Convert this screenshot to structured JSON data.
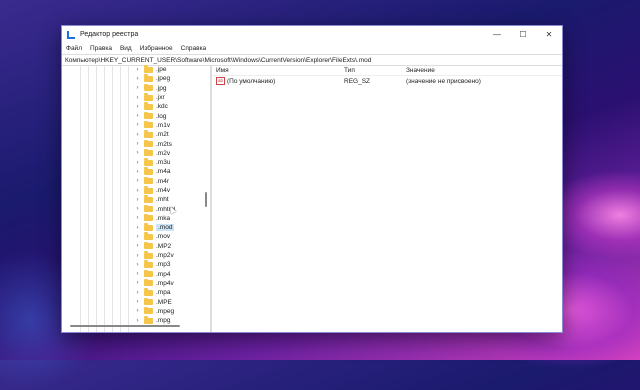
{
  "window": {
    "title": "Редактор реестра",
    "controls": {
      "minimize": "—",
      "maximize": "☐",
      "close": "✕"
    }
  },
  "menu": [
    "Файл",
    "Правка",
    "Вид",
    "Избранное",
    "Справка"
  ],
  "address": "Компьютер\\HKEY_CURRENT_USER\\Software\\Microsoft\\Windows\\CurrentVersion\\Explorer\\FileExts\\.mod",
  "tree": {
    "items": [
      ".jpe",
      ".jpeg",
      ".jpg",
      ".jxr",
      ".kdc",
      ".log",
      ".m1v",
      ".m2t",
      ".m2ts",
      ".m2v",
      ".m3u",
      ".m4a",
      ".m4r",
      ".m4v",
      ".mht",
      ".mhtml",
      ".mka",
      ".mod",
      ".mov",
      ".MP2",
      ".mp2v",
      ".mp3",
      ".mp4",
      ".mp4v",
      ".mpa",
      ".MPE",
      ".mpeg",
      ".mpg"
    ],
    "selected": ".mod"
  },
  "values": {
    "headers": {
      "name": "Имя",
      "type": "Тип",
      "data": "Значение"
    },
    "rows": [
      {
        "icon": "ab",
        "name": "(По умолчанию)",
        "type": "REG_SZ",
        "data": "(значение не присвоено)"
      }
    ]
  }
}
